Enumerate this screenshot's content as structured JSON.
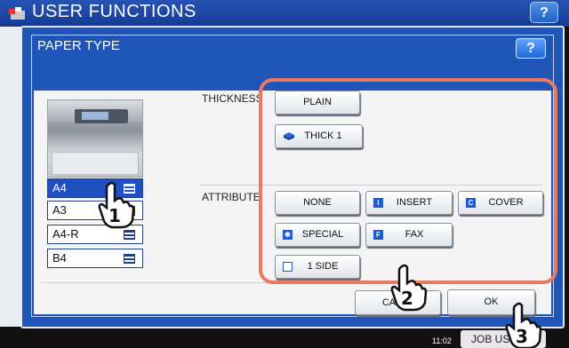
{
  "background_window": {
    "title": "USER FUNCTIONS",
    "help_label": "?",
    "clock": "11:02",
    "job_status_label": "JOB    US"
  },
  "dialog": {
    "title": "PAPER TYPE",
    "help_label": "?"
  },
  "trays": [
    {
      "label": "A4",
      "selected": true
    },
    {
      "label": "A3",
      "selected": false
    },
    {
      "label": "A4-R",
      "selected": false
    },
    {
      "label": "B4",
      "selected": false
    }
  ],
  "thickness": {
    "label": "THICKNESS",
    "options": [
      {
        "label": "PLAIN",
        "icon": ""
      },
      {
        "label": "THICK 1",
        "icon": "thick-paper-icon"
      }
    ]
  },
  "attribute": {
    "label": "ATTRIBUTE",
    "options": [
      {
        "label": "NONE",
        "icon": ""
      },
      {
        "label": "INSERT",
        "icon": "insert-icon",
        "icon_glyph": "I"
      },
      {
        "label": "COVER",
        "icon": "cover-icon",
        "icon_glyph": "C"
      },
      {
        "label": "SPECIAL",
        "icon": "special-icon",
        "icon_glyph": "✱"
      },
      {
        "label": "FAX",
        "icon": "fax-icon",
        "icon_glyph": "F"
      },
      {
        "label": "1 SIDE",
        "icon": "one-side-icon",
        "icon_glyph": ""
      }
    ]
  },
  "actions": {
    "cancel_label": "CA",
    "ok_label": "OK"
  },
  "annotations": {
    "step1": "1",
    "step2": "2",
    "step3": "3"
  },
  "colors": {
    "highlight": "#ea7b5f",
    "title_bar": "#1f54b8",
    "selected_tray": "#1f4fc0"
  }
}
